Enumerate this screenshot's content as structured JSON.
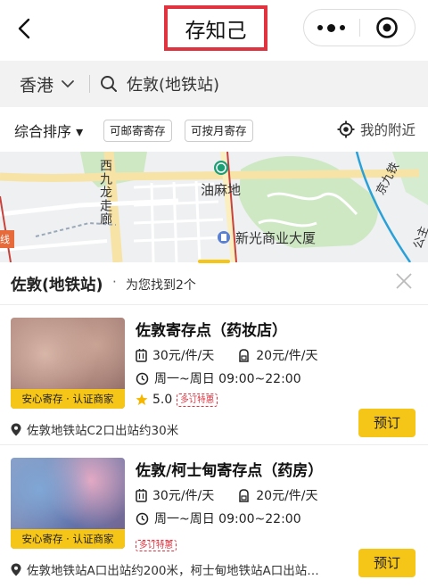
{
  "header": {
    "title": "存知己",
    "back_icon": "chevron-left-icon",
    "more_icon": "more-dots-icon",
    "home_icon": "target-icon"
  },
  "search": {
    "city": "香港",
    "query": "佐敦(地铁站)"
  },
  "filters": {
    "sort_label": "综合排序 ▾",
    "chips": [
      "可邮寄寄存",
      "可按月寄存"
    ],
    "nearby_label": "我的附近"
  },
  "map": {
    "labels": {
      "west_kowloon": "西九龙走廊",
      "yau_ma_tei": "油麻地",
      "sun_kwong": "新光商业大厦",
      "line_left": "线",
      "jing_jiu": "京九铁",
      "right_edge": "公主"
    }
  },
  "results": {
    "title": "佐敦(地铁站)",
    "dot": "·",
    "count_text": "为您找到2个",
    "items": [
      {
        "name": "佐敦寄存点（药妆店）",
        "price_small": "30元/件/天",
        "price_large": "20元/件/天",
        "hours": "周一~周日 09:00~22:00",
        "rating": "5.0",
        "promo": "多订特惠",
        "badge": "安心寄存 · 认证商家",
        "address": "佐敦地铁站C2口出站约30米",
        "book_label": "预订"
      },
      {
        "name": "佐敦/柯士甸寄存点（药房）",
        "price_small": "30元/件/天",
        "price_large": "20元/件/天",
        "hours": "周一~周日 09:00~22:00",
        "promo": "多订特惠",
        "badge": "安心寄存 · 认证商家",
        "address": "佐敦地铁站A口出站约200米，柯士甸地铁站A口出站…",
        "book_label": "预订"
      }
    ]
  },
  "colors": {
    "accent_yellow": "#f5c518",
    "highlight_red": "#e0323f",
    "map_green": "#cfe8c4",
    "map_road": "#f7e3a5"
  }
}
